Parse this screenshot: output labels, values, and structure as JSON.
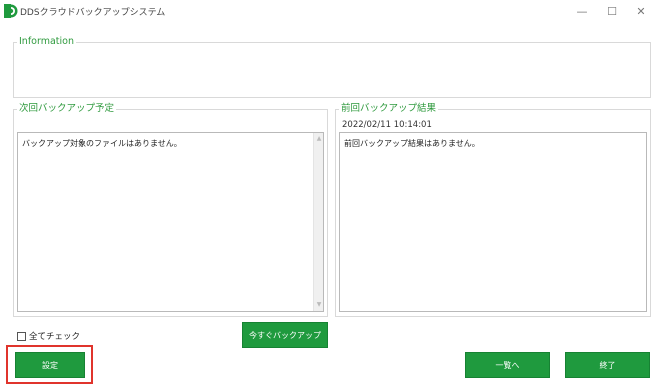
{
  "window": {
    "title": "DDSクラウドバックアップシステム",
    "minimize_icon": "—",
    "maximize_icon": "☐",
    "close_icon": "✕"
  },
  "information": {
    "label": "Information",
    "content": ""
  },
  "next_backup": {
    "label": "次回バックアップ予定",
    "content": "バックアップ対象のファイルはありません。"
  },
  "previous_backup": {
    "label": "前回バックアップ結果",
    "date": "2022/02/11 10:14:01",
    "content": "前回バックアップ結果はありません。"
  },
  "controls": {
    "check_all_label": "全てチェック",
    "check_all_checked": false,
    "backup_now_label": "今すぐバックアップ",
    "settings_label": "設定",
    "list_label": "一覧へ",
    "exit_label": "終了"
  },
  "colors": {
    "accent_green": "#1f9a3e",
    "label_green": "#2f9a3e",
    "highlight_red": "#e0342c"
  }
}
